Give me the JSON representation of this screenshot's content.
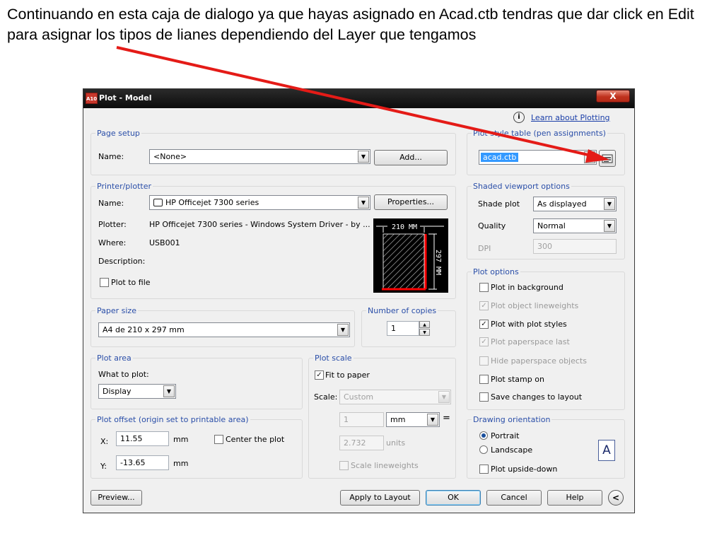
{
  "caption": "Continuando en esta caja de dialogo ya que hayas asignado en Acad.ctb tendras que dar click en Edit para asignar los tipos de lianes dependiendo del Layer que tengamos",
  "window": {
    "title": "Plot - Model",
    "app_icon": "A10",
    "close": "X"
  },
  "help_link": "Learn about Plotting",
  "page_setup": {
    "title": "Page setup",
    "name_label": "Name:",
    "name_value": "<None>",
    "add_button": "Add..."
  },
  "printer": {
    "title": "Printer/plotter",
    "name_label": "Name:",
    "name_value": "HP Officejet 7300 series",
    "properties_button": "Properties...",
    "plotter_label": "Plotter:",
    "plotter_value": "HP Officejet 7300 series - Windows System Driver - by ...",
    "where_label": "Where:",
    "where_value": "USB001",
    "description_label": "Description:",
    "plot_to_file": "Plot to file",
    "preview_width": "210 MM",
    "preview_height": "297 MM"
  },
  "paper_size": {
    "title": "Paper size",
    "value": "A4 de 210 x 297 mm"
  },
  "copies": {
    "title": "Number of copies",
    "value": "1"
  },
  "plot_area": {
    "title": "Plot area",
    "what_label": "What to plot:",
    "what_value": "Display"
  },
  "plot_offset": {
    "title": "Plot offset (origin set to printable area)",
    "x_label": "X:",
    "x_value": "11.55",
    "x_unit": "mm",
    "y_label": "Y:",
    "y_value": "-13.65",
    "y_unit": "mm",
    "center_label": "Center the plot"
  },
  "plot_scale": {
    "title": "Plot scale",
    "fit_label": "Fit to paper",
    "scale_label": "Scale:",
    "scale_value": "Custom",
    "num_value": "1",
    "unit_value": "mm",
    "equals": "=",
    "units_value": "2.732",
    "units_label": "units",
    "lineweights_label": "Scale lineweights"
  },
  "plot_style_table": {
    "title": "Plot style table (pen assignments)",
    "value": "acad.ctb"
  },
  "shaded": {
    "title": "Shaded viewport options",
    "shade_label": "Shade plot",
    "shade_value": "As displayed",
    "quality_label": "Quality",
    "quality_value": "Normal",
    "dpi_label": "DPI",
    "dpi_value": "300"
  },
  "plot_options": {
    "title": "Plot options",
    "items": [
      {
        "label": "Plot in background",
        "checked": false,
        "disabled": false
      },
      {
        "label": "Plot object lineweights",
        "checked": true,
        "disabled": true
      },
      {
        "label": "Plot with plot styles",
        "checked": true,
        "disabled": false
      },
      {
        "label": "Plot paperspace last",
        "checked": true,
        "disabled": true
      },
      {
        "label": "Hide paperspace objects",
        "checked": false,
        "disabled": true
      },
      {
        "label": "Plot stamp on",
        "checked": false,
        "disabled": false
      },
      {
        "label": "Save changes to layout",
        "checked": false,
        "disabled": false
      }
    ]
  },
  "orientation": {
    "title": "Drawing orientation",
    "portrait": "Portrait",
    "landscape": "Landscape",
    "upside_down": "Plot upside-down",
    "icon_letter": "A"
  },
  "footer": {
    "preview": "Preview...",
    "apply": "Apply to Layout",
    "ok": "OK",
    "cancel": "Cancel",
    "help": "Help",
    "more": "<"
  },
  "colors": {
    "group_title": "#2a4ea8",
    "arrow": "#e41b17",
    "selection": "#3399ff"
  }
}
